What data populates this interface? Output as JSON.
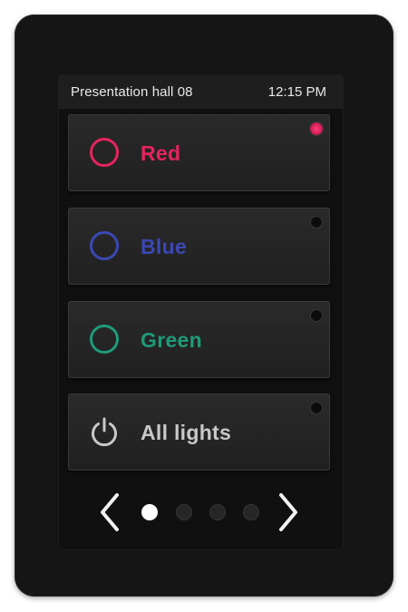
{
  "header": {
    "room_name": "Presentation hall 08",
    "time": "12:15 PM"
  },
  "buttons": [
    {
      "label": "Red",
      "icon": "ring-icon",
      "color": "#e6245f",
      "led_on": true
    },
    {
      "label": "Blue",
      "icon": "ring-icon",
      "color": "#3b48b3",
      "led_on": false
    },
    {
      "label": "Green",
      "icon": "ring-icon",
      "color": "#1f9a78",
      "led_on": false
    },
    {
      "label": "All lights",
      "icon": "power-icon",
      "color": "#c9c9c9",
      "led_on": false
    }
  ],
  "pagination": {
    "pages": 4,
    "current": 1
  },
  "colors": {
    "bezel": "#151515",
    "button_face": "#242424",
    "led_active": "#e6245f",
    "status_text": "#e9e9e9"
  }
}
